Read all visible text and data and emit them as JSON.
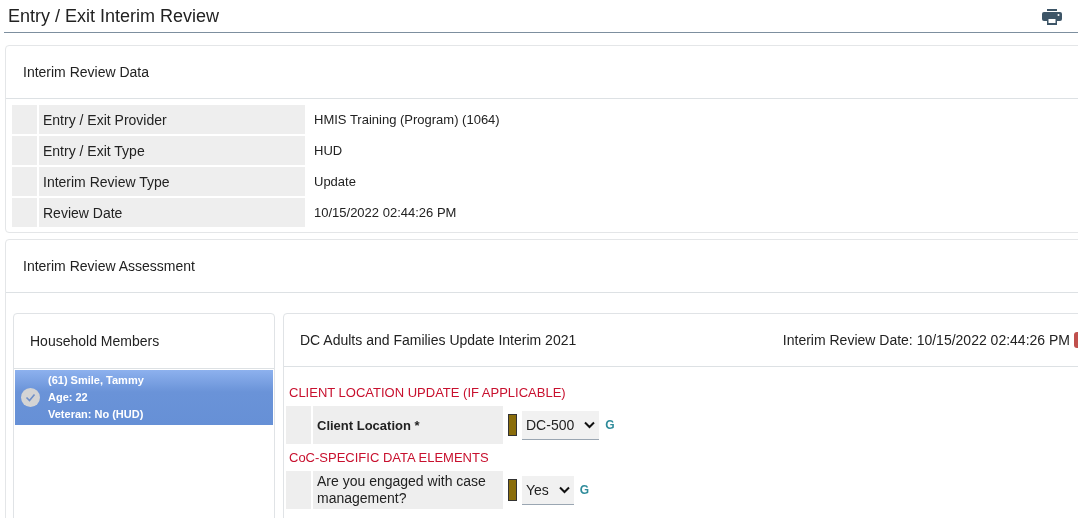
{
  "page": {
    "title": "Entry / Exit Interim Review"
  },
  "review_data": {
    "title": "Interim Review Data",
    "rows": [
      {
        "label": "Entry / Exit Provider",
        "value": "HMIS Training (Program) (1064)"
      },
      {
        "label": "Entry / Exit Type",
        "value": "HUD"
      },
      {
        "label": "Interim Review Type",
        "value": "Update"
      },
      {
        "label": "Review Date",
        "value": "10/15/2022 02:44:26 PM"
      }
    ]
  },
  "assessment": {
    "title": "Interim Review Assessment",
    "household": {
      "title": "Household Members",
      "members": [
        {
          "name": "(61) Smile, Tammy",
          "age": "Age: 22",
          "veteran": "Veteran: No (HUD)",
          "selected": true
        }
      ]
    },
    "form": {
      "title": "DC Adults and Families Update Interim 2021",
      "date": "Interim Review Date: 10/15/2022 02:44:26 PM",
      "sections": [
        {
          "heading": "CLIENT LOCATION UPDATE (IF APPLICABLE)",
          "fields": [
            {
              "label": "Client Location *",
              "required": true,
              "value": "DC-500",
              "link": "G"
            }
          ]
        },
        {
          "heading": "CoC-SPECIFIC DATA ELEMENTS",
          "fields": [
            {
              "label": "Are you engaged with case management?",
              "required": false,
              "value": "Yes",
              "link": "G"
            }
          ]
        }
      ]
    }
  }
}
